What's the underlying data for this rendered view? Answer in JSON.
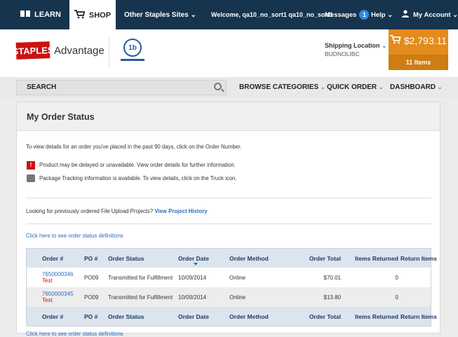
{
  "topbar": {
    "learn_label": "LEARN",
    "shop_label": "SHOP",
    "other_sites_label": "Other Staples Sites ⌄",
    "welcome_text": "Welcome, qa10_no_sort1 qa10_no_sort1",
    "messages_label": "Messages",
    "messages_count": "1",
    "help_label": "Help ⌄",
    "account_label": "My Account ⌄"
  },
  "header": {
    "logo_text": "STAPLES",
    "logo_suffix": "Advantage",
    "customer_logo_text": "1b",
    "shipping_label": "Shipping Location",
    "shipping_value": "BUDNOLIBC",
    "cart_total": "$2,793.11",
    "cart_items": "11 Items"
  },
  "nav": {
    "search_label": "SEARCH",
    "browse_label": "BROWSE CATEGORIES",
    "quick_order_label": "QUICK ORDER",
    "dashboard_label": "DASHBOARD"
  },
  "panel": {
    "title": "My Order Status",
    "intro": "To view details for an order you've placed in the past 90 days, click on the Order Number.",
    "delayed_note": "Product may be delayed or unavailable. View order details for further information.",
    "tracking_note": "Package Tracking information is available. To view details, click on the Truck icon.",
    "upload_prefix": "Looking for previously ordered File Upload Projects?",
    "upload_link": "View Project History",
    "definitions_link": "Click here to see order status definitions"
  },
  "table": {
    "headers": [
      "Order #",
      "PO #",
      "Order Status",
      "Order Date",
      "Order Method",
      "Order Total",
      "Items Returned",
      "Return Items"
    ],
    "rows": [
      {
        "order": "7650000346",
        "tag": "Test",
        "po": "PO09",
        "status": "Transmitted for Fulfillment",
        "date": "10/09/2014",
        "method": "Online",
        "total": "$70.01",
        "returned": "0",
        "return_items": ""
      },
      {
        "order": "7650000345",
        "tag": "Test",
        "po": "PO09",
        "status": "Transmitted for Fulfillment",
        "date": "10/09/2014",
        "method": "Online",
        "total": "$13.80",
        "returned": "0",
        "return_items": ""
      }
    ]
  },
  "colors": {
    "topbar": "#17344e",
    "cart": "#e48b1d",
    "link": "#2a6ebb",
    "brand_red": "#cc1111"
  }
}
